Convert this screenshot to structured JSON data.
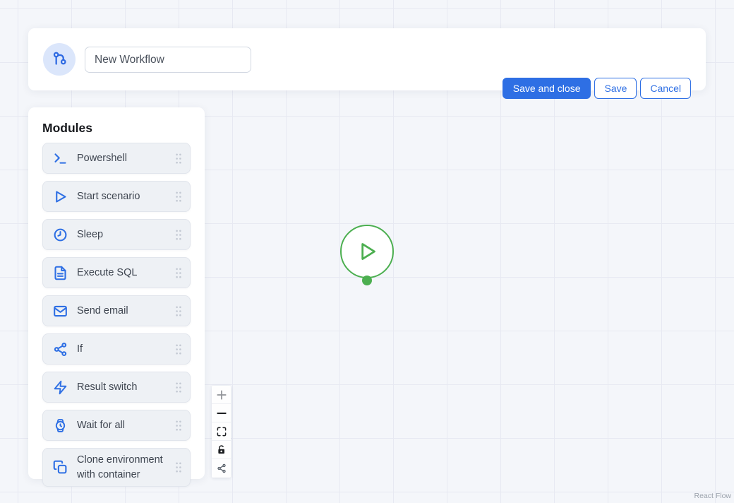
{
  "header": {
    "badge_icon": "workflow-branch-icon",
    "name_input": {
      "value": "New Workflow"
    },
    "save_and_close_label": "Save and close",
    "save_label": "Save",
    "cancel_label": "Cancel"
  },
  "modules": {
    "title": "Modules",
    "items": [
      {
        "label": "Powershell",
        "icon": "terminal-icon"
      },
      {
        "label": "Start scenario",
        "icon": "play-icon"
      },
      {
        "label": "Sleep",
        "icon": "clock-icon"
      },
      {
        "label": "Execute SQL",
        "icon": "file-text-icon"
      },
      {
        "label": "Send email",
        "icon": "mail-icon"
      },
      {
        "label": "If",
        "icon": "branch-share-icon"
      },
      {
        "label": "Result switch",
        "icon": "zap-icon"
      },
      {
        "label": "Wait for all",
        "icon": "watch-icon"
      },
      {
        "label": "Clone environment with container",
        "icon": "copy-icon"
      }
    ]
  },
  "canvas": {
    "start_node": {
      "type": "start",
      "icon": "play-circle-icon"
    },
    "controls": [
      {
        "action": "zoom-in",
        "icon": "plus-icon"
      },
      {
        "action": "zoom-out",
        "icon": "minus-icon"
      },
      {
        "action": "fit-view",
        "icon": "fit-view-icon"
      },
      {
        "action": "toggle-interactivity",
        "icon": "lock-icon"
      },
      {
        "action": "share",
        "icon": "share-icon"
      }
    ],
    "attribution": "React Flow"
  },
  "colors": {
    "accent_blue": "#2e6fe4",
    "badge_bg": "#dbe6fb",
    "node_green": "#4caf50",
    "canvas_bg": "#f4f6fa",
    "grid_line": "#e7e9f2",
    "card_bg": "#eef1f5"
  }
}
